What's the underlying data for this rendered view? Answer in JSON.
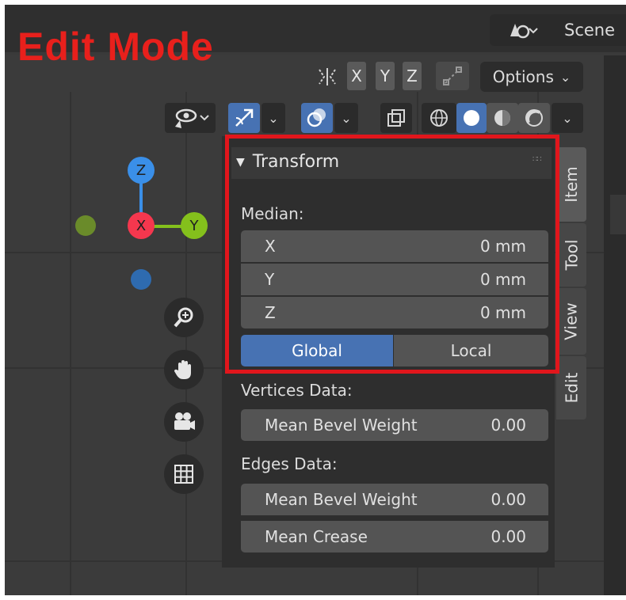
{
  "annotation": {
    "title": "Edit Mode"
  },
  "header": {
    "scene_label": "Scene",
    "options_label": "Options"
  },
  "axis_toggles": [
    "X",
    "Y",
    "Z"
  ],
  "gizmo": {
    "x_label": "X",
    "y_label": "Y",
    "z_label": "Z"
  },
  "panel": {
    "title": "Transform",
    "median_label": "Median:",
    "fields": [
      {
        "axis": "X",
        "value": "0 mm"
      },
      {
        "axis": "Y",
        "value": "0 mm"
      },
      {
        "axis": "Z",
        "value": "0 mm"
      }
    ],
    "space_options": {
      "global": "Global",
      "local": "Local",
      "selected": "Global"
    },
    "vertices_label": "Vertices Data:",
    "vertices_fields": [
      {
        "label": "Mean Bevel Weight",
        "value": "0.00"
      }
    ],
    "edges_label": "Edges Data:",
    "edges_fields": [
      {
        "label": "Mean Bevel Weight",
        "value": "0.00"
      },
      {
        "label": "Mean Crease",
        "value": "0.00"
      }
    ]
  },
  "tabs": [
    "Item",
    "Tool",
    "View",
    "Edit"
  ],
  "colors": {
    "annotation_red": "#e8201c",
    "accent_blue": "#4772b3",
    "axis_x": "#f5374e",
    "axis_y": "#84c01c",
    "axis_z": "#3a8fe8"
  }
}
